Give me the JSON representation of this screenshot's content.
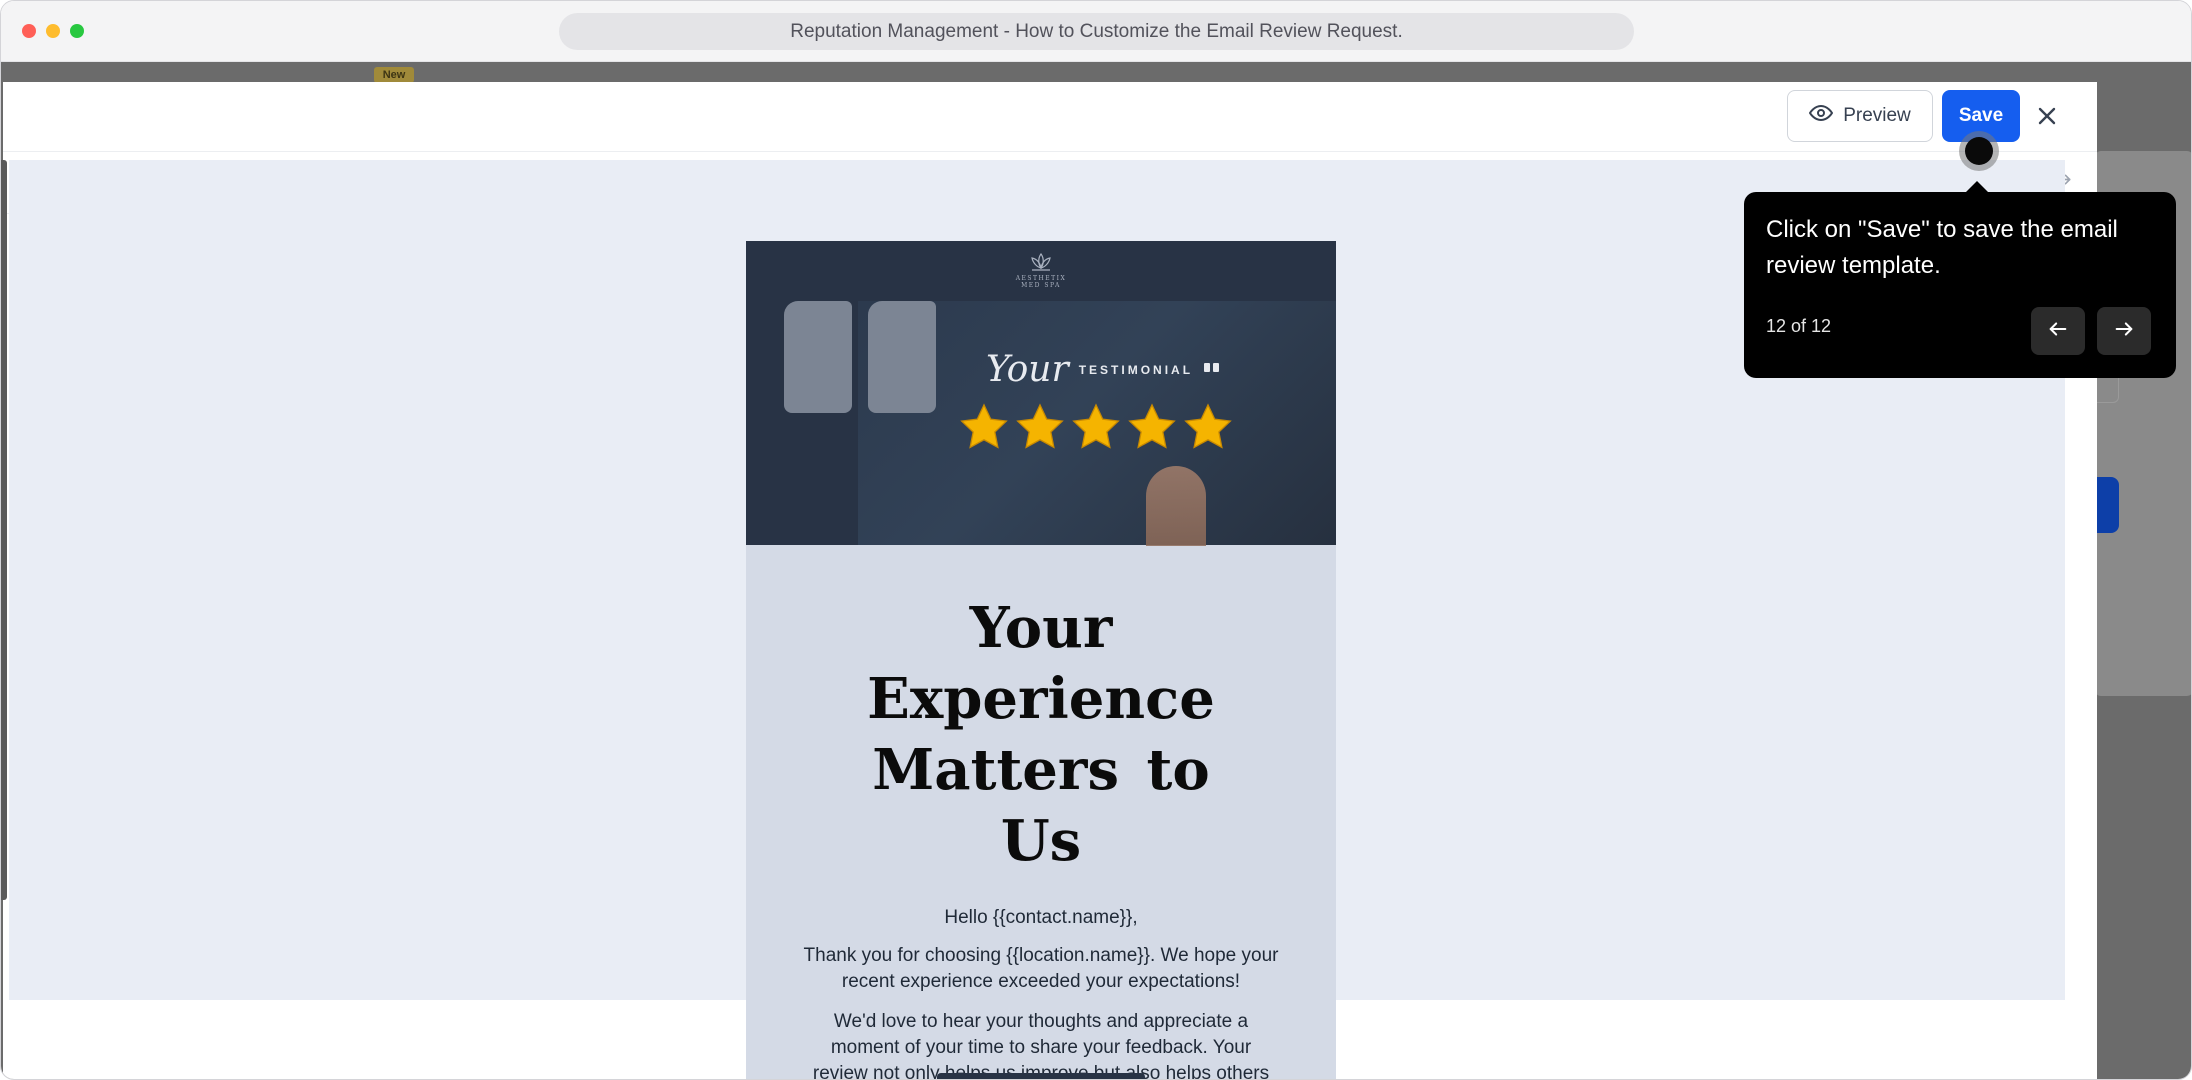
{
  "browser": {
    "title": "Reputation Management - How to Customize the Email Review Request."
  },
  "background_app": {
    "new_badge": "New"
  },
  "editor": {
    "preview_label": "Preview",
    "save_label": "Save",
    "icons": {
      "close": "close-icon",
      "builder": "tools-icon",
      "desktop": "desktop-icon",
      "mobile": "mobile-icon",
      "undo": "undo-icon",
      "redo": "redo-icon",
      "preview": "eye-icon"
    },
    "active_view": "mobile",
    "accent_color": "#155eef"
  },
  "email": {
    "logo_text": "AESTHETIX MED SPA",
    "testimonial_script": "Your",
    "testimonial_label": "TESTIMONIAL",
    "star_rating": 5,
    "headline": "Your Experience Matters to Us",
    "greeting": "Hello {{contact.name}},",
    "paragraph1": "Thank you for choosing {{location.name}}. We hope your recent experience exceeded your expectations!",
    "paragraph2": "We'd love to hear your thoughts and appreciate a moment of your time to share your feedback. Your review not only helps us improve but also helps others discover our services.",
    "hero_color": "#283345",
    "body_color": "#d4dae6",
    "star_color": "#f5b400"
  },
  "tooltip": {
    "text": "Click on \"Save\" to save the email review template.",
    "step": "12 of 12",
    "prev_icon": "arrow-left-icon",
    "next_icon": "arrow-right-icon"
  }
}
